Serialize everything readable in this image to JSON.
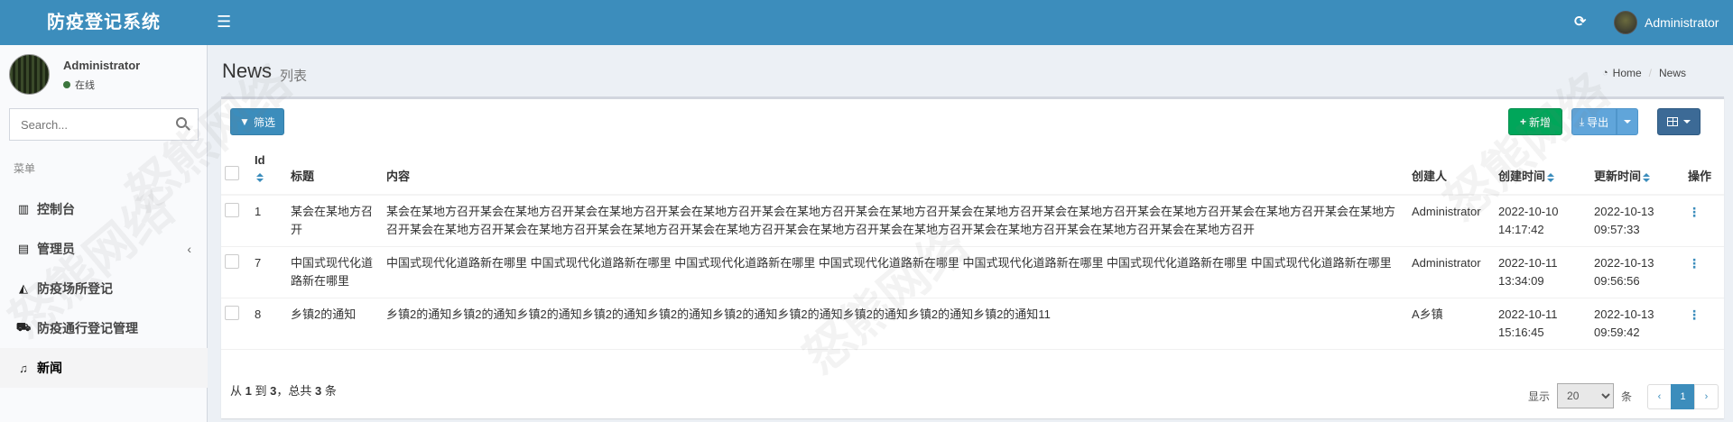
{
  "app": {
    "title": "防疫登记系统",
    "user_name": "Administrator"
  },
  "icons": {
    "menu_toggle": "bars-icon",
    "refresh": "refresh-icon",
    "search": "search-icon"
  },
  "sidebar": {
    "user_name": "Administrator",
    "status": "在线",
    "search_placeholder": "Search...",
    "menu_header": "菜单",
    "items": [
      {
        "label": "控制台",
        "icon": "bar-chart-icon"
      },
      {
        "label": "管理员",
        "icon": "users-icon",
        "chevron": "‹"
      },
      {
        "label": "防疫场所登记",
        "icon": "area-chart-icon"
      },
      {
        "label": "防疫通行登记管理",
        "icon": "car-icon"
      },
      {
        "label": "新闻",
        "icon": "bell-icon",
        "active": true
      }
    ]
  },
  "page": {
    "title": "News",
    "subtitle": "列表",
    "breadcrumb": {
      "home": "Home",
      "current": "News"
    }
  },
  "toolbar": {
    "filter_label": "筛选",
    "add_label": "新增",
    "export_label": "导出"
  },
  "table": {
    "headers": {
      "id": "Id",
      "title": "标题",
      "content": "内容",
      "creator": "创建人",
      "created": "创建时间",
      "updated": "更新时间",
      "op": "操作"
    },
    "rows": [
      {
        "id": "1",
        "title": "某会在某地方召开",
        "content": "某会在某地方召开某会在某地方召开某会在某地方召开某会在某地方召开某会在某地方召开某会在某地方召开某会在某地方召开某会在某地方召开某会在某地方召开某会在某地方召开某会在某地方召开某会在某地方召开某会在某地方召开某会在某地方召开某会在某地方召开某会在某地方召开某会在某地方召开某会在某地方召开某会在某地方召开某会在某地方召开",
        "creator": "Administrator",
        "created_date": "2022-10-10",
        "created_time": "14:17:42",
        "updated_date": "2022-10-13",
        "updated_time": "09:57:33"
      },
      {
        "id": "7",
        "title": "中国式现代化道路新在哪里",
        "content": "中国式现代化道路新在哪里 中国式现代化道路新在哪里 中国式现代化道路新在哪里 中国式现代化道路新在哪里 中国式现代化道路新在哪里 中国式现代化道路新在哪里 中国式现代化道路新在哪里",
        "creator": "Administrator",
        "created_date": "2022-10-11",
        "created_time": "13:34:09",
        "updated_date": "2022-10-13",
        "updated_time": "09:56:56"
      },
      {
        "id": "8",
        "title": "乡镇2的通知",
        "content": "乡镇2的通知乡镇2的通知乡镇2的通知乡镇2的通知乡镇2的通知乡镇2的通知乡镇2的通知乡镇2的通知乡镇2的通知乡镇2的通知11",
        "creator": "A乡镇",
        "created_date": "2022-10-11",
        "created_time": "15:16:45",
        "updated_date": "2022-10-13",
        "updated_time": "09:59:42"
      }
    ]
  },
  "footer": {
    "info_prefix": "从",
    "info_from": "1",
    "info_to_word": "到",
    "info_to": "3",
    "info_total_word": "，总共",
    "info_total": "3",
    "info_suffix": "条",
    "show_label": "显示",
    "page_size": "20",
    "rows_label": "条",
    "prev": "‹",
    "current_page": "1",
    "next": "›"
  },
  "watermark": "怒熊网络"
}
